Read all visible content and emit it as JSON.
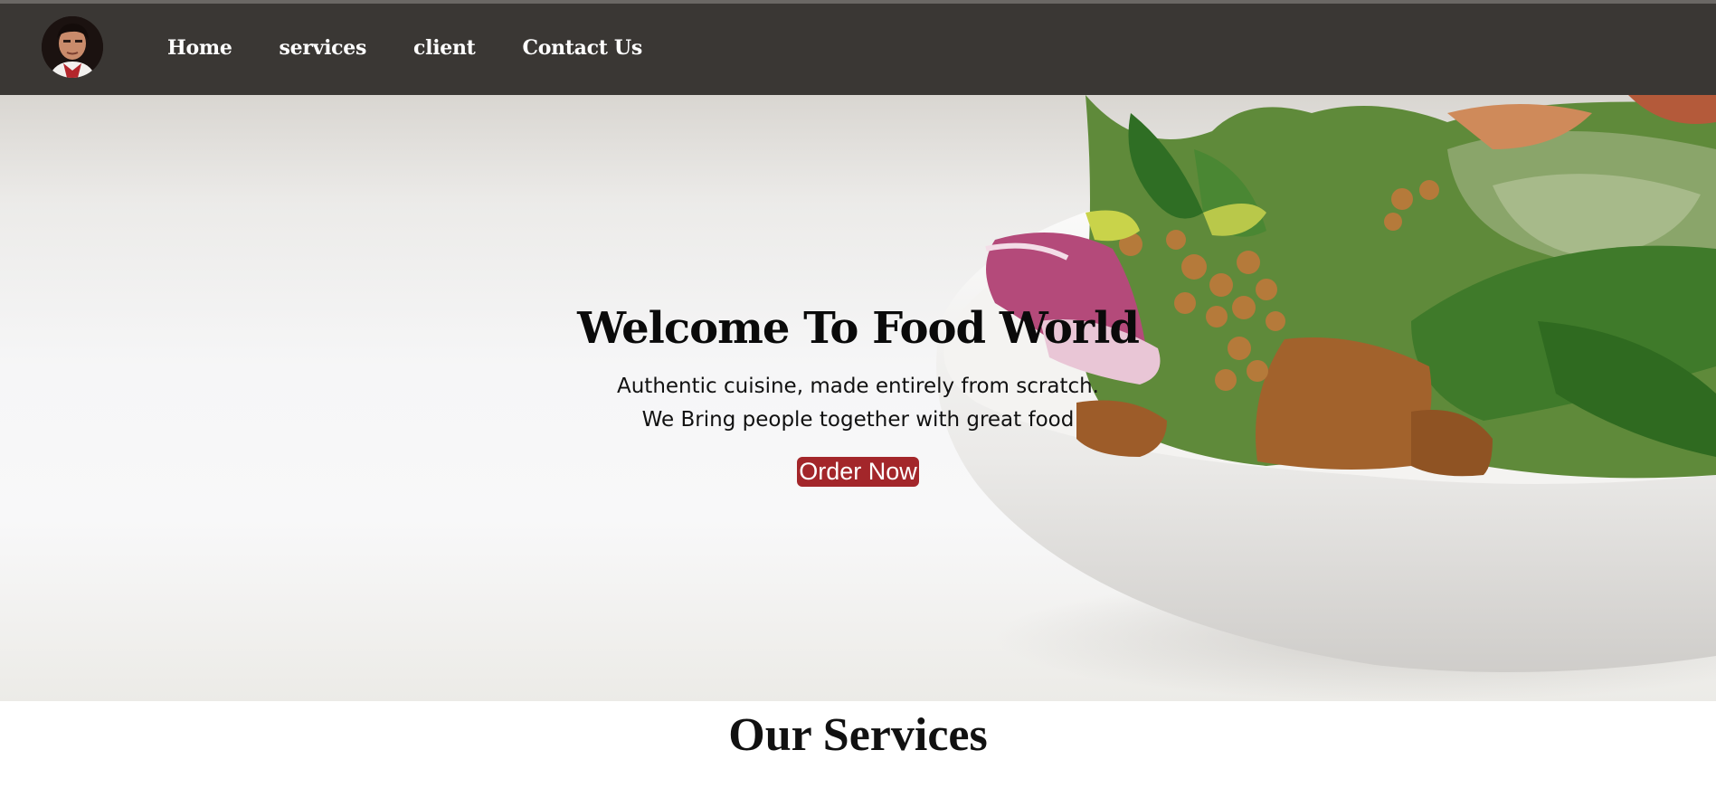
{
  "nav": {
    "avatar_alt": "profile photo",
    "links": [
      {
        "label": "Home"
      },
      {
        "label": "services"
      },
      {
        "label": "client"
      },
      {
        "label": "Contact Us"
      }
    ]
  },
  "hero": {
    "title": "Welcome To Food World",
    "subtitle_line1": "Authentic cuisine, made entirely from scratch.",
    "subtitle_line2": "We Bring people together with great food",
    "button_label": "Order Now"
  },
  "services": {
    "heading": "Our Services"
  },
  "colors": {
    "navbar_bg": "#3a3734",
    "button_bg": "#a3262a",
    "text_dark": "#0a0a0a"
  }
}
